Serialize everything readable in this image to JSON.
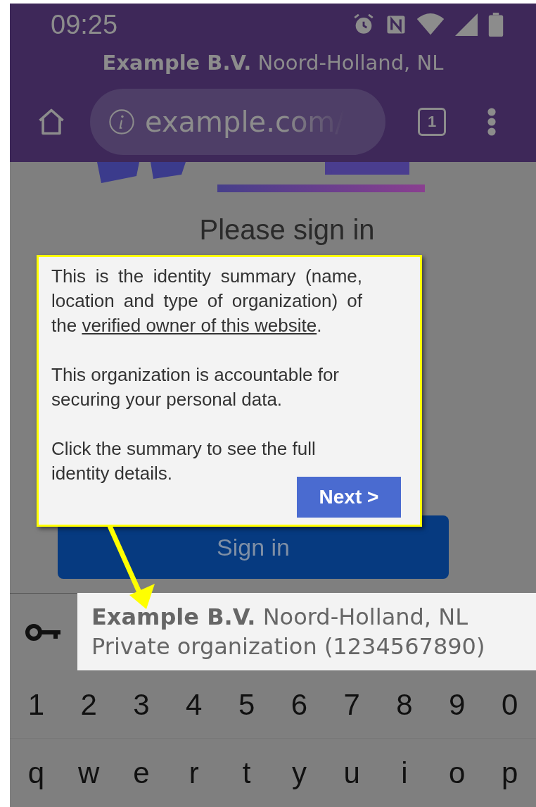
{
  "status_bar": {
    "time": "09:25"
  },
  "identity_header": {
    "name": "Example B.V.",
    "location": "Noord-Holland, NL"
  },
  "toolbar": {
    "url": "example.com/",
    "tab_count": "1"
  },
  "page": {
    "heading": "Please sign in",
    "sign_in_button": "Sign in"
  },
  "tooltip": {
    "paragraphs": [
      {
        "before": "This is the identity summary (name, location and type of organization) of the ",
        "link": "verified owner of this website",
        "after": "."
      },
      {
        "before": "This organization is accountable for securing your personal data."
      },
      {
        "before": "Click the summary to see the full identity details."
      }
    ],
    "next_button": "Next >"
  },
  "identity_strip": {
    "name": "Example B.V.",
    "location": "Noord-Holland, NL",
    "type": "Private organization (1234567890)"
  },
  "keyboard": {
    "rows": [
      [
        "1",
        "2",
        "3",
        "4",
        "5",
        "6",
        "7",
        "8",
        "9",
        "0"
      ],
      [
        "q",
        "w",
        "e",
        "r",
        "t",
        "y",
        "u",
        "i",
        "o",
        "p"
      ]
    ]
  }
}
